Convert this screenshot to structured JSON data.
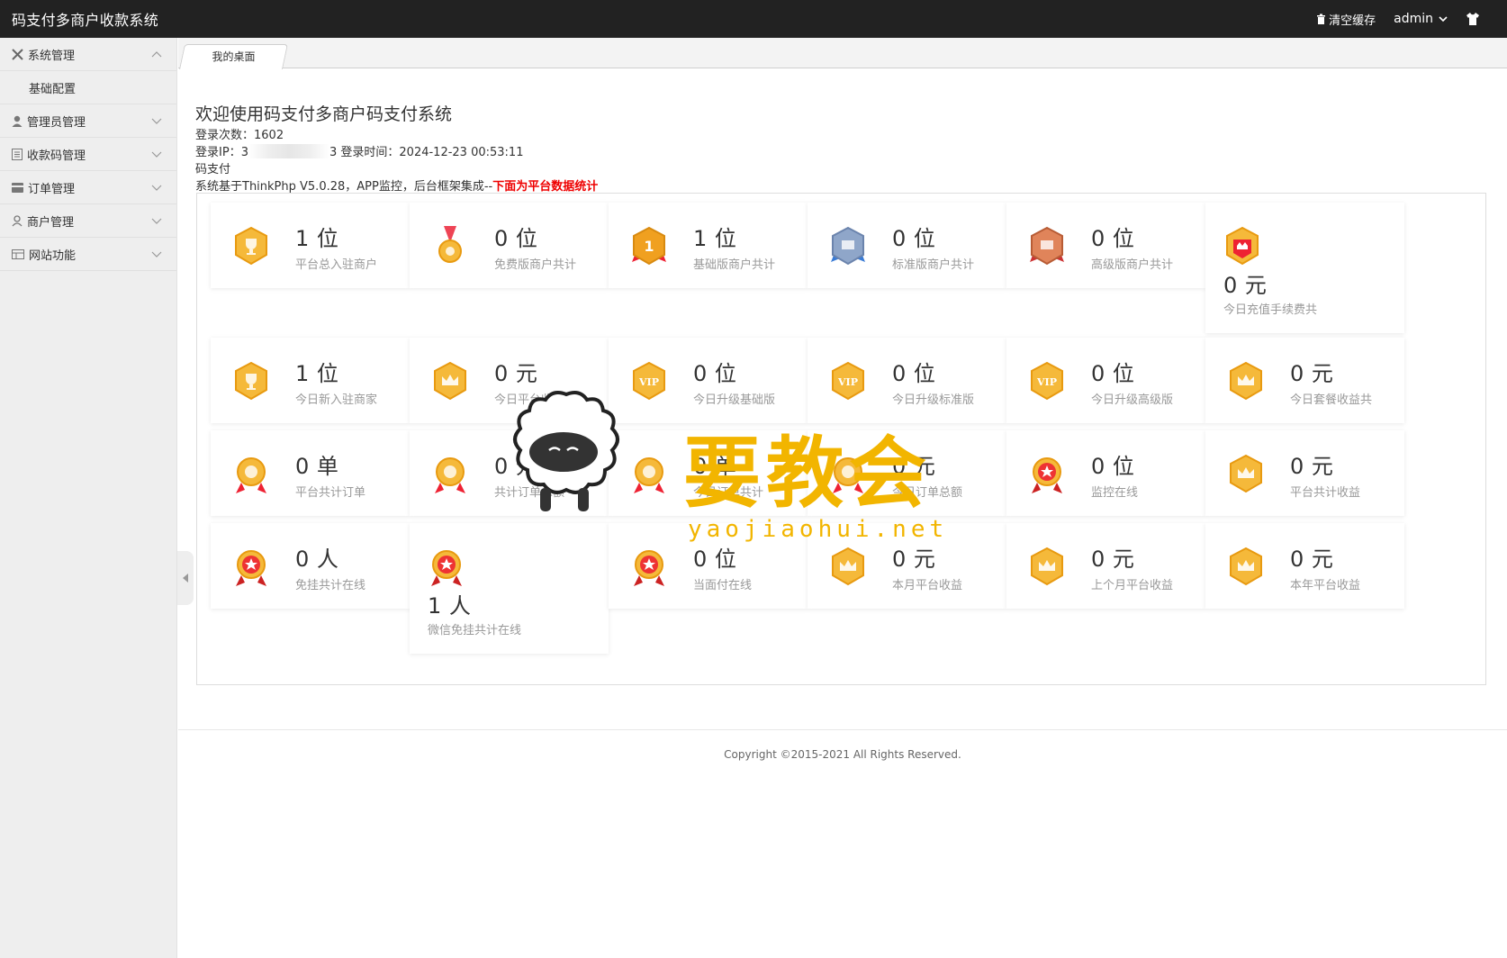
{
  "header": {
    "brand": "码支付多商户收款系统",
    "clear_cache": "清空缓存",
    "user": "admin"
  },
  "sidebar": {
    "items": [
      {
        "label": "系统管理",
        "icon": "tools-icon",
        "expanded": true,
        "children": [
          "基础配置"
        ]
      },
      {
        "label": "管理员管理",
        "icon": "user-icon"
      },
      {
        "label": "收款码管理",
        "icon": "list-icon"
      },
      {
        "label": "订单管理",
        "icon": "card-icon"
      },
      {
        "label": "商户管理",
        "icon": "merchant-icon"
      },
      {
        "label": "网站功能",
        "icon": "grid-icon"
      }
    ]
  },
  "tabs": [
    {
      "label": "我的桌面"
    }
  ],
  "welcome": {
    "title": "欢迎使用码支付多商户码支付系统",
    "login_count_label": "登录次数：",
    "login_count": "1602",
    "login_ip_label": "登录IP：",
    "login_ip_prefix": "3",
    "login_ip_suffix": "3",
    "login_time_label": "登录时间：",
    "login_time": "2024-12-23 00:53:11",
    "line3": "码支付",
    "line4_prefix": "系统基于ThinkPhp V5.0.28，APP监控，后台框架集成--",
    "line4_red": "下面为平台数据统计"
  },
  "stats": [
    {
      "value": "1 位",
      "label": "平台总入驻商户",
      "medal": "trophy-hex",
      "color": "#f5b93a"
    },
    {
      "value": "0 位",
      "label": "免费版商户共计",
      "medal": "ribbon-medal",
      "color": "#f5b93a"
    },
    {
      "value": "1 位",
      "label": "基础版商户共计",
      "medal": "number-one-hex",
      "color": "#f0a020"
    },
    {
      "value": "0 位",
      "label": "标准版商户共计",
      "medal": "silver-hex",
      "color": "#8fa6c9"
    },
    {
      "value": "0 位",
      "label": "高级版商户共计",
      "medal": "bronze-hex",
      "color": "#e0845a"
    },
    {
      "value": "0 元",
      "label": "今日充值手续费共",
      "medal": "red-hex",
      "color": "#f5b93a"
    },
    {
      "value": "1 位",
      "label": "今日新入驻商家",
      "medal": "trophy-hex",
      "color": "#f5b93a"
    },
    {
      "value": "0 元",
      "label": "今日平台收益共",
      "medal": "crown-hex",
      "color": "#f5b93a"
    },
    {
      "value": "0 位",
      "label": "今日升级基础版",
      "medal": "vip-hex",
      "color": "#f5b93a"
    },
    {
      "value": "0 位",
      "label": "今日升级标准版",
      "medal": "vip-hex",
      "color": "#f5b93a"
    },
    {
      "value": "0 位",
      "label": "今日升级高级版",
      "medal": "vip-hex",
      "color": "#f5b93a"
    },
    {
      "value": "0 元",
      "label": "今日套餐收益共",
      "medal": "crown-hex",
      "color": "#f5b93a"
    },
    {
      "value": "0 单",
      "label": "平台共计订单",
      "medal": "flower-medal",
      "color": "#f5b93a"
    },
    {
      "value": "0 元",
      "label": "共计订单总额",
      "medal": "flower-medal",
      "color": "#f5b93a"
    },
    {
      "value": "0 单",
      "label": "今日订单共计",
      "medal": "flower-medal",
      "color": "#f5b93a"
    },
    {
      "value": "0 元",
      "label": "今日订单总额",
      "medal": "flower-medal",
      "color": "#f5b93a"
    },
    {
      "value": "0 位",
      "label": "监控在线",
      "medal": "red-star-medal",
      "color": "#e33"
    },
    {
      "value": "0 元",
      "label": "平台共计收益",
      "medal": "crown-hex",
      "color": "#f5b93a"
    },
    {
      "value": "0 人",
      "label": "免挂共计在线",
      "medal": "red-star-medal",
      "color": "#e33"
    },
    {
      "value": "1 人",
      "label": "微信免挂共计在线",
      "medal": "red-star-medal",
      "color": "#e33"
    },
    {
      "value": "0 位",
      "label": "当面付在线",
      "medal": "red-star-medal",
      "color": "#e33"
    },
    {
      "value": "0 元",
      "label": "本月平台收益",
      "medal": "crown-hex",
      "color": "#f5b93a"
    },
    {
      "value": "0 元",
      "label": "上个月平台收益",
      "medal": "crown-hex",
      "color": "#f5b93a"
    },
    {
      "value": "0 元",
      "label": "本年平台收益",
      "medal": "crown-hex",
      "color": "#f5b93a"
    }
  ],
  "footer": {
    "copyright": "Copyright ©2015-2021 All Rights Reserved."
  },
  "watermark": {
    "text": "要教会",
    "url": "yaojiaohui.net"
  }
}
